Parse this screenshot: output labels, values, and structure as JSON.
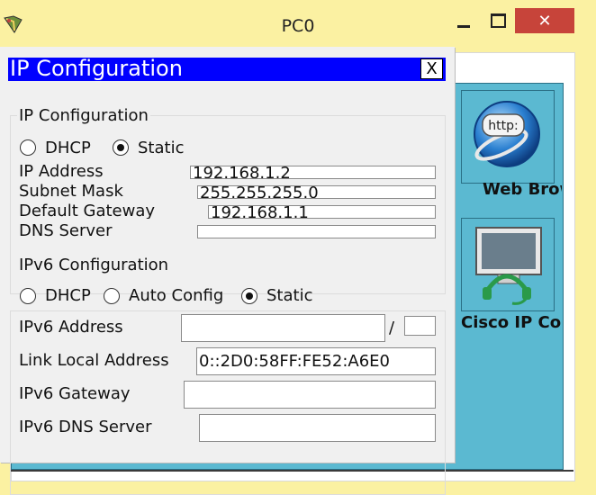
{
  "window": {
    "title": "PC0",
    "close_label": "✕"
  },
  "dialog": {
    "title": "IP Configuration",
    "close_label": "X"
  },
  "ipv4": {
    "group_title": "IP Configuration",
    "dhcp_label": "DHCP",
    "static_label": "Static",
    "mode": "Static",
    "ip_label": "IP Address",
    "ip_value": "192.168.1.2",
    "mask_label": "Subnet Mask",
    "mask_value": "255.255.255.0",
    "gateway_label": "Default Gateway",
    "gateway_value": "192.168.1.1",
    "dns_label": "DNS Server",
    "dns_value": ""
  },
  "ipv6": {
    "group_title": "IPv6 Configuration",
    "dhcp_label": "DHCP",
    "auto_label": "Auto Config",
    "static_label": "Static",
    "mode": "Static",
    "address_label": "IPv6 Address",
    "address_value": "",
    "prefix_sep": "/",
    "prefix_value": "",
    "link_local_label": "Link Local Address",
    "link_local_value": "0::2D0:58FF:FE52:A6E0",
    "gateway_label": "IPv6 Gateway",
    "gateway_value": "",
    "dns_label": "IPv6 DNS Server",
    "dns_value": ""
  },
  "desktop_apps": {
    "web_browser_label": "Web Browser",
    "web_browser_icon_text": "http:",
    "cisco_label": "Cisco IP Communicator"
  },
  "colors": {
    "dialog_title_bg": "#0000ff",
    "desktop_bg": "#5bb9d1",
    "window_frame": "#fbf1a2",
    "close_button": "#c7443a"
  }
}
